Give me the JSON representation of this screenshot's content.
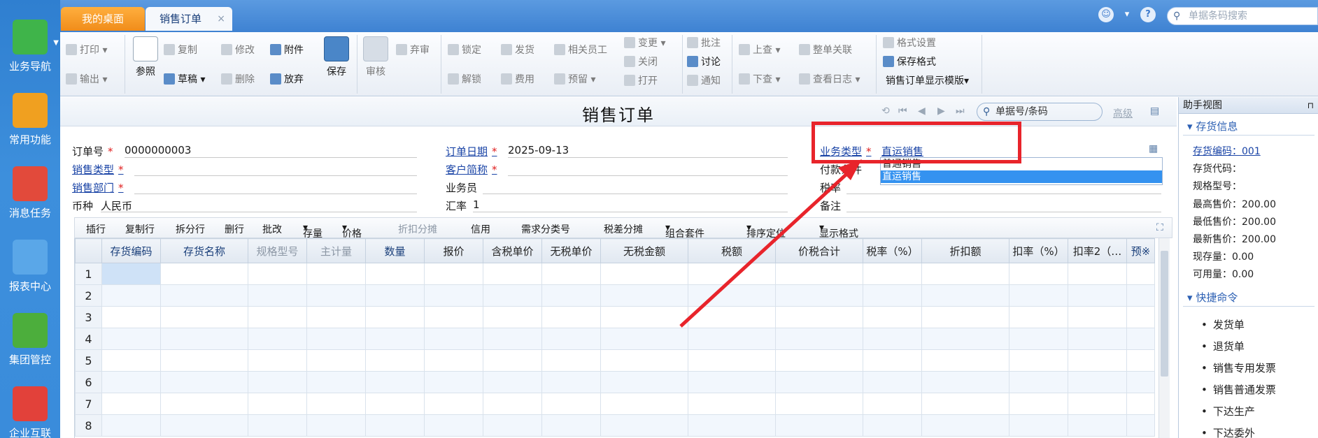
{
  "nav": {
    "items": [
      {
        "label": "业务导航"
      },
      {
        "label": "常用功能"
      },
      {
        "label": "消息任务"
      },
      {
        "label": "报表中心"
      },
      {
        "label": "集团管控"
      },
      {
        "label": "企业互联"
      }
    ]
  },
  "tabs": [
    {
      "label": "我的桌面"
    },
    {
      "label": "销售订单"
    }
  ],
  "top": {
    "search_placeholder": "单据条码搜索",
    "close": "×"
  },
  "toolbar": {
    "print": "打印",
    "export": "输出",
    "ref": "参照",
    "copy": "复制",
    "draft": "草稿",
    "modify": "修改",
    "delete": "删除",
    "attach": "附件",
    "giveup": "放弃",
    "save": "保存",
    "audit": "审核",
    "abandon": "弃审",
    "lock": "锁定",
    "unlock": "解锁",
    "ship": "发货",
    "fee": "费用",
    "staff": "相关员工",
    "reserve": "预留",
    "change": "变更",
    "close": "关闭",
    "open": "打开",
    "annotate": "批注",
    "discuss": "讨论",
    "notify": "通知",
    "up": "上查",
    "down": "下查",
    "whole": "整单关联",
    "log": "查看日志",
    "fmt": "格式设置",
    "savefmt": "保存格式",
    "tpl": "销售订单显示模版"
  },
  "form": {
    "title": "销售订单",
    "search": "单据号/条码",
    "advanced": "高级",
    "order_no_label": "订单号",
    "order_no": "0000000003",
    "date_label": "订单日期",
    "date": "2025-09-13",
    "biz_type_label": "业务类型",
    "biz_type": "直运销售",
    "sale_type_label": "销售类型",
    "customer_label": "客户简称",
    "pay_label": "付款条件",
    "dept_label": "销售部门",
    "salesman_label": "业务员",
    "tax_label": "税率",
    "currency_label": "币种",
    "currency": "人民币",
    "rate_label": "汇率",
    "rate": "1",
    "note_label": "备注",
    "dropdown": [
      "普通销售",
      "直运销售"
    ]
  },
  "grid_toolbar": [
    "插行",
    "复制行",
    "拆分行",
    "删行",
    "批改",
    "存量",
    "价格",
    "折扣分摊",
    "信用",
    "需求分类号",
    "税差分摊",
    "组合套件",
    "排序定位",
    "显示格式"
  ],
  "grid": {
    "headers": [
      "存货编码",
      "存货名称",
      "规格型号",
      "主计量",
      "数量",
      "报价",
      "含税单价",
      "无税单价",
      "无税金额",
      "税额",
      "价税合计",
      "税率（%）",
      "折扣额",
      "扣率（%）",
      "扣率2（…",
      "预※"
    ],
    "rows": [
      "1",
      "2",
      "3",
      "4",
      "5",
      "6",
      "7",
      "8"
    ]
  },
  "helper": {
    "title": "助手视图",
    "pin": "⊓",
    "stock_section": "存货信息",
    "fields": [
      "存货编码：001",
      "存货代码：",
      "规格型号：",
      "最高售价：200.00",
      "最低售价：200.00",
      "最新售价：200.00",
      "现存量：0.00",
      "可用量：0.00"
    ],
    "cmd_section": "快捷命令",
    "cmds": [
      "发货单",
      "退货单",
      "销售专用发票",
      "销售普通发票",
      "下达生产",
      "下达委外"
    ]
  }
}
